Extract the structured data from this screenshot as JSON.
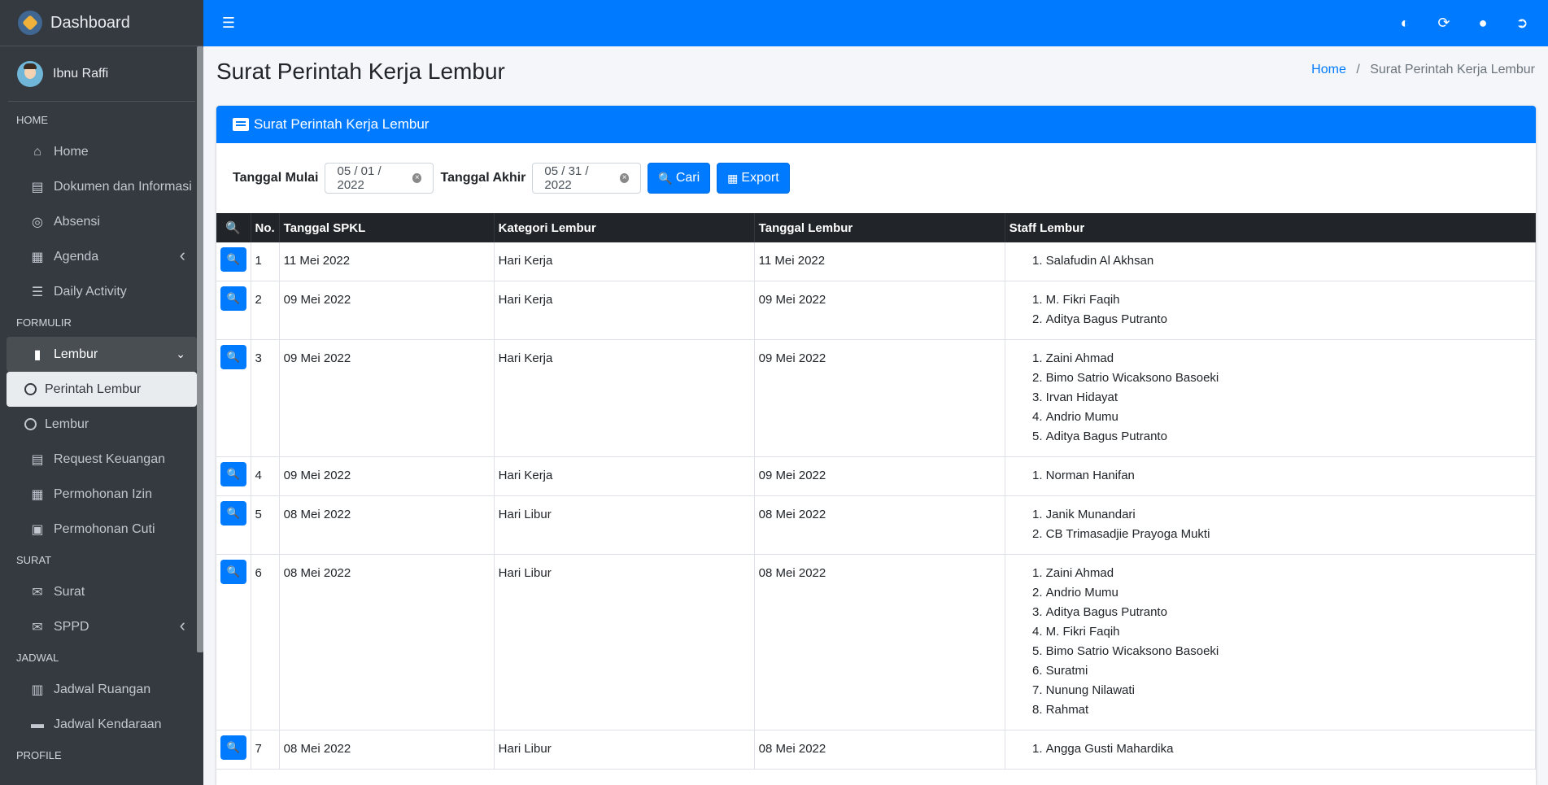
{
  "brand": {
    "title": "Dashboard"
  },
  "user": {
    "name": "Ibnu Raffi"
  },
  "sidebar": {
    "sections": [
      {
        "header": "HOME",
        "items": [
          {
            "label": "Home",
            "icon": "home-icon"
          },
          {
            "label": "Dokumen dan Informasi",
            "icon": "book-icon"
          },
          {
            "label": "Absensi",
            "icon": "fingerprint-icon"
          },
          {
            "label": "Agenda",
            "icon": "calendar-icon",
            "arrow": "left"
          },
          {
            "label": "Daily Activity",
            "icon": "list-icon"
          }
        ]
      },
      {
        "header": "FORMULIR",
        "items": [
          {
            "label": "Lembur",
            "icon": "clipboard-icon",
            "arrow": "down",
            "open": true
          },
          {
            "label": "Perintah Lembur",
            "sub": true,
            "active": true
          },
          {
            "label": "Lembur",
            "sub": true
          },
          {
            "label": "Request Keuangan",
            "icon": "receipt-icon"
          },
          {
            "label": "Permohonan Izin",
            "icon": "calendar-icon"
          },
          {
            "label": "Permohonan Cuti",
            "icon": "suitcase-icon"
          }
        ]
      },
      {
        "header": "SURAT",
        "items": [
          {
            "label": "Surat",
            "icon": "envelope-icon"
          },
          {
            "label": "SPPD",
            "icon": "envelope-icon",
            "arrow": "left"
          }
        ]
      },
      {
        "header": "JADWAL",
        "items": [
          {
            "label": "Jadwal Ruangan",
            "icon": "building-icon"
          },
          {
            "label": "Jadwal Kendaraan",
            "icon": "car-icon"
          }
        ]
      },
      {
        "header": "PROFILE",
        "items": []
      }
    ]
  },
  "page": {
    "title": "Surat Perintah Kerja Lembur",
    "breadcrumb_home": "Home",
    "breadcrumb_current": "Surat Perintah Kerja Lembur"
  },
  "card": {
    "title": "Surat Perintah Kerja Lembur"
  },
  "filter": {
    "start_label": "Tanggal Mulai",
    "start_value": "05 / 01 / 2022",
    "end_label": "Tanggal Akhir",
    "end_value": "05 / 31 / 2022",
    "search_label": "Cari",
    "export_label": "Export"
  },
  "table": {
    "columns": [
      "No.",
      "Tanggal SPKL",
      "Kategori Lembur",
      "Tanggal Lembur",
      "Staff Lembur"
    ],
    "rows": [
      {
        "no": "1",
        "tgl_spkl": "11 Mei 2022",
        "kategori": "Hari Kerja",
        "tgl_lembur": "11 Mei 2022",
        "staff": [
          "Salafudin Al Akhsan"
        ]
      },
      {
        "no": "2",
        "tgl_spkl": "09 Mei 2022",
        "kategori": "Hari Kerja",
        "tgl_lembur": "09 Mei 2022",
        "staff": [
          "M. Fikri Faqih",
          "Aditya Bagus Putranto"
        ]
      },
      {
        "no": "3",
        "tgl_spkl": "09 Mei 2022",
        "kategori": "Hari Kerja",
        "tgl_lembur": "09 Mei 2022",
        "staff": [
          "Zaini Ahmad",
          "Bimo Satrio Wicaksono Basoeki",
          "Irvan Hidayat",
          "Andrio Mumu",
          "Aditya Bagus Putranto"
        ]
      },
      {
        "no": "4",
        "tgl_spkl": "09 Mei 2022",
        "kategori": "Hari Kerja",
        "tgl_lembur": "09 Mei 2022",
        "staff": [
          "Norman Hanifan"
        ]
      },
      {
        "no": "5",
        "tgl_spkl": "08 Mei 2022",
        "kategori": "Hari Libur",
        "tgl_lembur": "08 Mei 2022",
        "staff": [
          "Janik Munandari",
          "CB Trimasadjie Prayoga Mukti"
        ]
      },
      {
        "no": "6",
        "tgl_spkl": "08 Mei 2022",
        "kategori": "Hari Libur",
        "tgl_lembur": "08 Mei 2022",
        "staff": [
          "Zaini Ahmad",
          "Andrio Mumu",
          "Aditya Bagus Putranto",
          "M. Fikri Faqih",
          "Bimo Satrio Wicaksono Basoeki",
          "Suratmi",
          "Nunung Nilawati",
          "Rahmat"
        ]
      },
      {
        "no": "7",
        "tgl_spkl": "08 Mei 2022",
        "kategori": "Hari Libur",
        "tgl_lembur": "08 Mei 2022",
        "staff": [
          "Angga Gusti Mahardika"
        ]
      }
    ]
  },
  "colors": {
    "primary": "#007bff",
    "sidebar_bg": "#343a40",
    "table_head": "#212529"
  }
}
